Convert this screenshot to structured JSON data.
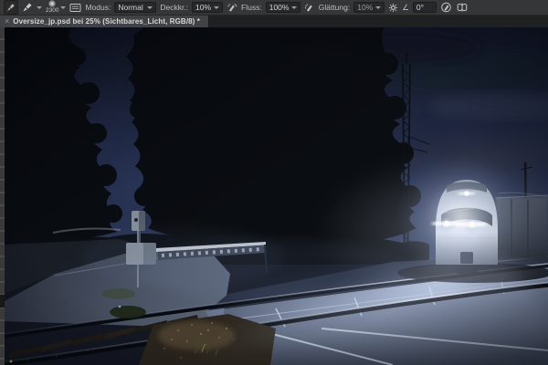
{
  "options_bar": {
    "brush_size": "2300",
    "mode_label": "Modus:",
    "mode_value": "Normal",
    "opacity_label": "Deckkr.:",
    "opacity_value": "10%",
    "flow_label": "Fluss:",
    "flow_value": "100%",
    "smoothing_label": "Glättung:",
    "smoothing_value": "10%",
    "angle_symbol": "∠",
    "angle_value": "0°"
  },
  "tab": {
    "close_glyph": "×",
    "title": "Oversize_jp.psd bei 25% (Sichtbares_Licht, RGB/8) *"
  },
  "canvas": {
    "file_name": "Oversize_jp.psd",
    "zoom": "25%",
    "active_layer": "Sichtbares_Licht",
    "color_mode": "RGB/8",
    "scene": "Night photograph: electric commuter train with three bright headlights approaching a rural level crossing; lowered barrier and signal at left, lattice catenary mast at right, dark tree silhouettes against deep blue sky, headlights illuminating fog and the concrete crossing panels; railway track with sleepers runs through the lower-left foreground",
    "colors": {
      "sky_top": "#171c2e",
      "sky_mid": "#28314e",
      "tree_silhouette": "#0a0d11",
      "headlight_glow": "#f4f8ff",
      "crossing_deck_lit": "#aebdd8",
      "road": "#3c4454",
      "train_front": "#ccd3da",
      "barrier": "#c9ced6"
    }
  }
}
